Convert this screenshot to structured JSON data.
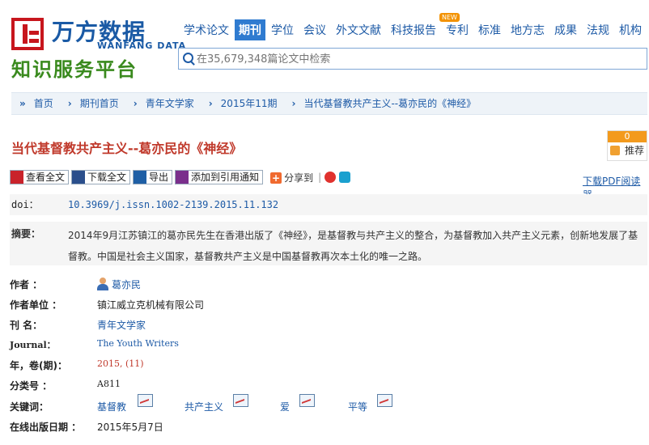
{
  "logo": {
    "cn": "万方数据",
    "en": "WANFANG DATA",
    "slogan": "知识服务平台"
  },
  "nav": {
    "items": [
      "学术论文",
      "期刊",
      "学位",
      "会议",
      "外文文献",
      "科技报告",
      "专利",
      "标准",
      "地方志",
      "成果",
      "法规",
      "机构"
    ],
    "active": "期刊",
    "new_badge": "NEW"
  },
  "search": {
    "placeholder": "在35,679,348篇论文中检索"
  },
  "breadcrumb": [
    "首页",
    "期刊首页",
    "青年文学家",
    "2015年11期",
    "当代基督教共产主义--葛亦民的《神经》"
  ],
  "article": {
    "title": "当代基督教共产主义--葛亦民的《神经》",
    "recommend_count": "0",
    "recommend_label": "推荐"
  },
  "actions": {
    "view_full": "查看全文",
    "download_full": "下载全文",
    "export": "导出",
    "add_citation": "添加到引用通知",
    "share": "分享到",
    "pdf_reader": "下载PDF阅读器"
  },
  "doi": {
    "label": "doi：",
    "value": "10.3969/j.issn.1002-2139.2015.11.132"
  },
  "abstract": {
    "label": "摘要：",
    "text": "2014年9月江苏镇江的葛亦民先生在香港出版了《神经》，是基督教与共产主义的整合，为基督教加入共产主义元素，创新地发展了基督教。中国是社会主义国家，基督教共产主义是中国基督教再次本土化的唯一之路。"
  },
  "fields": {
    "author_label": "作者 ：",
    "author": "葛亦民",
    "org_label": "作者单位 ：",
    "org": "镇江威立克机械有限公司",
    "journal_label": "刊  名：",
    "journal": "青年文学家",
    "journal_en_label": "Journal：",
    "journal_en": "The Youth Writers",
    "year_label": "年，卷(期)：",
    "year": "2015,  (11)",
    "class_label": "分类号 ：",
    "class": "A811",
    "keywords_label": "关键词：",
    "keywords": [
      "基督教",
      "共产主义",
      "爱",
      "平等"
    ],
    "date_label": "在线出版日期 ：",
    "date": "2015年5月7日"
  },
  "colors": {
    "brand_blue": "#1a5aa5",
    "brand_red": "#c7161d",
    "slogan_green": "#3a8a1e",
    "title_red": "#c0392b"
  }
}
